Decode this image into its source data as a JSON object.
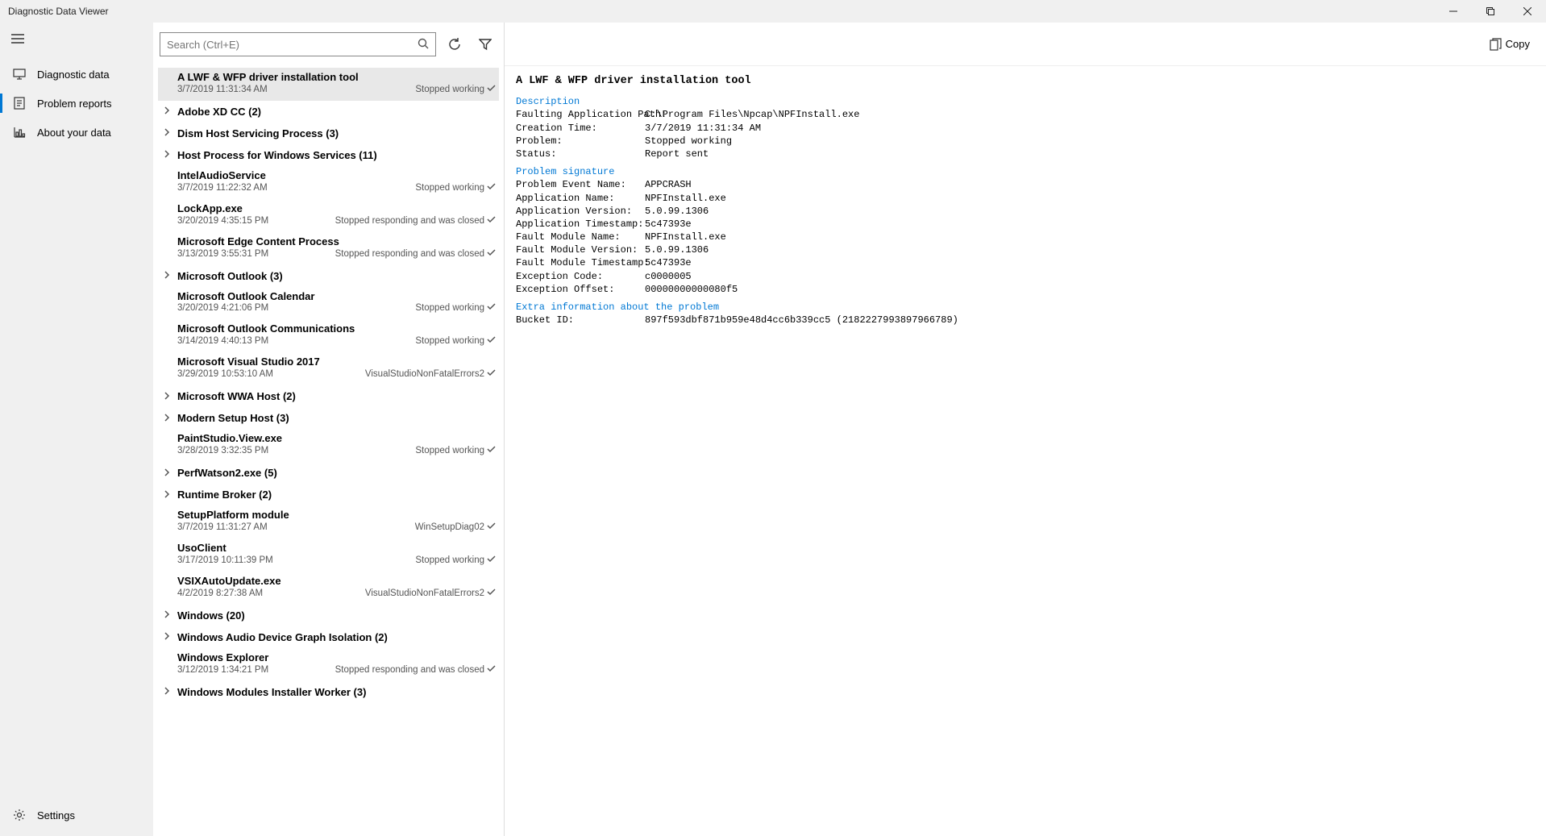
{
  "window_title": "Diagnostic Data Viewer",
  "search_placeholder": "Search (Ctrl+E)",
  "copy_label": "Copy",
  "sidebar": {
    "items": [
      {
        "label": "Diagnostic data"
      },
      {
        "label": "Problem reports"
      },
      {
        "label": "About your data"
      }
    ],
    "settings": "Settings"
  },
  "list": [
    {
      "type": "item",
      "title": "A LWF & WFP driver installation tool",
      "date": "3/7/2019 11:31:34 AM",
      "status": "Stopped working",
      "selected": true
    },
    {
      "type": "group",
      "title": "Adobe XD CC (2)"
    },
    {
      "type": "group",
      "title": "Dism Host Servicing Process (3)"
    },
    {
      "type": "group",
      "title": "Host Process for Windows Services (11)"
    },
    {
      "type": "item",
      "title": "IntelAudioService",
      "date": "3/7/2019 11:22:32 AM",
      "status": "Stopped working"
    },
    {
      "type": "item",
      "title": "LockApp.exe",
      "date": "3/20/2019 4:35:15 PM",
      "status": "Stopped responding and was closed"
    },
    {
      "type": "item",
      "title": "Microsoft Edge Content Process",
      "date": "3/13/2019 3:55:31 PM",
      "status": "Stopped responding and was closed"
    },
    {
      "type": "group",
      "title": "Microsoft Outlook (3)"
    },
    {
      "type": "item",
      "title": "Microsoft Outlook Calendar",
      "date": "3/20/2019 4:21:06 PM",
      "status": "Stopped working"
    },
    {
      "type": "item",
      "title": "Microsoft Outlook Communications",
      "date": "3/14/2019 4:40:13 PM",
      "status": "Stopped working"
    },
    {
      "type": "item",
      "title": "Microsoft Visual Studio 2017",
      "date": "3/29/2019 10:53:10 AM",
      "status": "VisualStudioNonFatalErrors2"
    },
    {
      "type": "group",
      "title": "Microsoft WWA Host (2)"
    },
    {
      "type": "group",
      "title": "Modern Setup Host (3)"
    },
    {
      "type": "item",
      "title": "PaintStudio.View.exe",
      "date": "3/28/2019 3:32:35 PM",
      "status": "Stopped working"
    },
    {
      "type": "group",
      "title": "PerfWatson2.exe (5)"
    },
    {
      "type": "group",
      "title": "Runtime Broker (2)"
    },
    {
      "type": "item",
      "title": "SetupPlatform module",
      "date": "3/7/2019 11:31:27 AM",
      "status": "WinSetupDiag02"
    },
    {
      "type": "item",
      "title": "UsoClient",
      "date": "3/17/2019 10:11:39 PM",
      "status": "Stopped working"
    },
    {
      "type": "item",
      "title": "VSIXAutoUpdate.exe",
      "date": "4/2/2019 8:27:38 AM",
      "status": "VisualStudioNonFatalErrors2"
    },
    {
      "type": "group",
      "title": "Windows (20)"
    },
    {
      "type": "group",
      "title": "Windows Audio Device Graph Isolation (2)"
    },
    {
      "type": "item",
      "title": "Windows Explorer",
      "date": "3/12/2019 1:34:21 PM",
      "status": "Stopped responding and was closed"
    },
    {
      "type": "group",
      "title": "Windows Modules Installer Worker (3)"
    }
  ],
  "detail": {
    "heading": "A LWF & WFP driver installation tool",
    "sections": [
      {
        "label": "Description",
        "rows": [
          {
            "k": "Faulting Application Path:",
            "v": "C:\\Program Files\\Npcap\\NPFInstall.exe"
          },
          {
            "k": "Creation Time:",
            "v": "3/7/2019 11:31:34 AM"
          },
          {
            "k": "Problem:",
            "v": "Stopped working"
          },
          {
            "k": "Status:",
            "v": "Report sent"
          }
        ]
      },
      {
        "label": "Problem signature",
        "rows": [
          {
            "k": "Problem Event Name:",
            "v": "APPCRASH"
          },
          {
            "k": "Application Name:",
            "v": "NPFInstall.exe"
          },
          {
            "k": "Application Version:",
            "v": "5.0.99.1306"
          },
          {
            "k": "Application Timestamp:",
            "v": "5c47393e"
          },
          {
            "k": "Fault Module Name:",
            "v": "NPFInstall.exe"
          },
          {
            "k": "Fault Module Version:",
            "v": "5.0.99.1306"
          },
          {
            "k": "Fault Module Timestamp:",
            "v": "5c47393e"
          },
          {
            "k": "Exception Code:",
            "v": "c0000005"
          },
          {
            "k": "Exception Offset:",
            "v": "00000000000080f5"
          }
        ]
      },
      {
        "label": "Extra information about the problem",
        "rows": [
          {
            "k": "Bucket ID:",
            "v": "897f593dbf871b959e48d4cc6b339cc5 (2182227993897966789)"
          }
        ]
      }
    ]
  }
}
